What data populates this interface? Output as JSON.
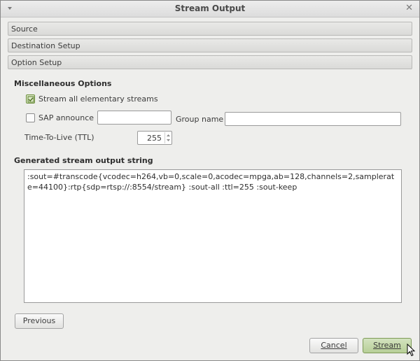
{
  "window": {
    "title": "Stream Output"
  },
  "sections": {
    "source": "Source",
    "destination": "Destination Setup",
    "option": "Option Setup"
  },
  "misc": {
    "heading": "Miscellaneous Options",
    "stream_all_label": "Stream all elementary streams",
    "stream_all_checked": true,
    "sap_label": "SAP announce",
    "sap_checked": false,
    "sap_value": "",
    "group_label": "Group name",
    "group_value": "",
    "ttl_label": "Time-To-Live (TTL)",
    "ttl_value": "255"
  },
  "output": {
    "heading": "Generated stream output string",
    "text": ":sout=#transcode{vcodec=h264,vb=0,scale=0,acodec=mpga,ab=128,channels=2,samplerate=44100}:rtp{sdp=rtsp://:8554/stream} :sout-all :ttl=255 :sout-keep"
  },
  "buttons": {
    "previous": "Previous",
    "cancel": "Cancel",
    "stream": "Stream"
  },
  "colors": {
    "accent_green": "#b7cf97",
    "window_bg": "#eeeeec"
  },
  "icons": {
    "window_menu": "chevron-down-icon",
    "close": "close-icon",
    "check": "check-icon",
    "spin_up": "chevron-up-icon",
    "spin_down": "chevron-down-icon",
    "cursor": "mouse-pointer-icon"
  }
}
